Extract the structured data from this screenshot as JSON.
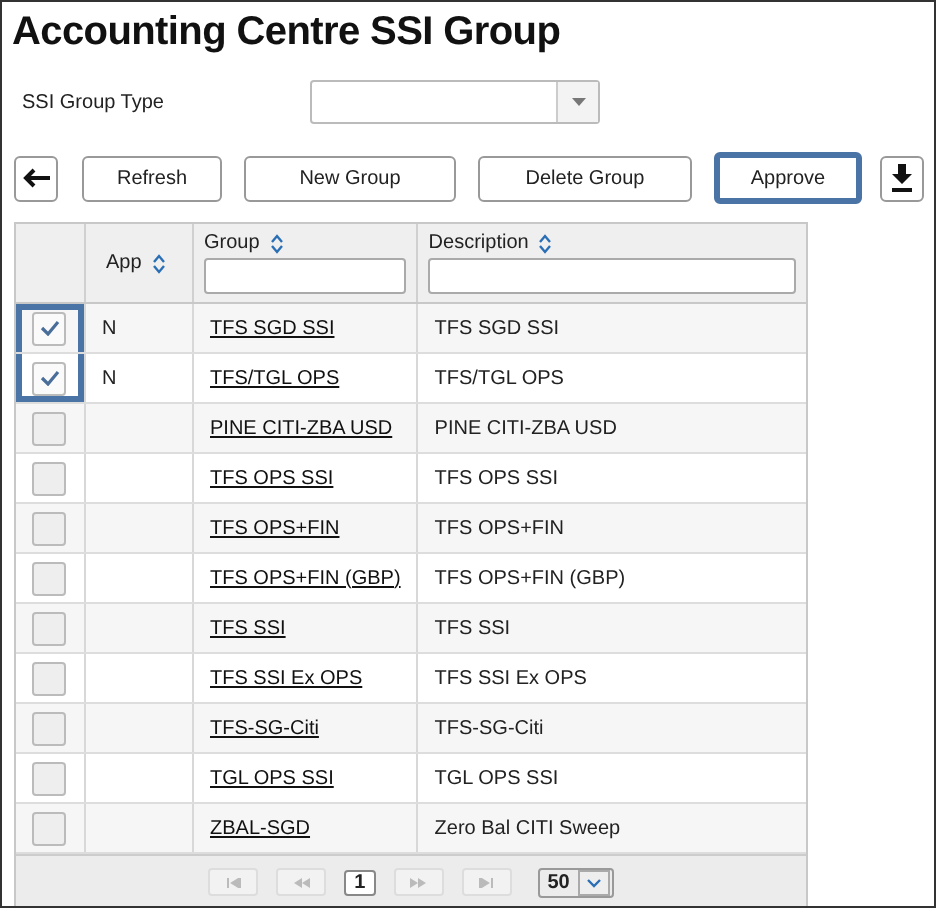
{
  "title": "Accounting Centre SSI Group",
  "filter": {
    "label": "SSI Group Type"
  },
  "toolbar": {
    "buttons": [
      {
        "label": "Refresh",
        "highlighted": false
      },
      {
        "label": "New Group",
        "highlighted": false
      },
      {
        "label": "Delete Group",
        "highlighted": false
      },
      {
        "label": "Approve",
        "highlighted": true
      }
    ]
  },
  "table": {
    "columns": [
      {
        "label": "App",
        "filter": false
      },
      {
        "label": "Group",
        "filter": true
      },
      {
        "label": "Description",
        "filter": true
      }
    ],
    "rows": [
      {
        "checked": true,
        "highlighted": true,
        "app": "N",
        "group": "TFS SGD SSI",
        "description": "TFS SGD SSI"
      },
      {
        "checked": true,
        "highlighted": true,
        "app": "N",
        "group": "TFS/TGL OPS",
        "description": "TFS/TGL OPS"
      },
      {
        "checked": false,
        "highlighted": false,
        "app": "",
        "group": "PINE CITI-ZBA USD",
        "description": "PINE CITI-ZBA USD"
      },
      {
        "checked": false,
        "highlighted": false,
        "app": "",
        "group": "TFS OPS SSI",
        "description": "TFS OPS SSI"
      },
      {
        "checked": false,
        "highlighted": false,
        "app": "",
        "group": "TFS OPS+FIN",
        "description": "TFS OPS+FIN"
      },
      {
        "checked": false,
        "highlighted": false,
        "app": "",
        "group": "TFS OPS+FIN (GBP)",
        "description": "TFS OPS+FIN (GBP)"
      },
      {
        "checked": false,
        "highlighted": false,
        "app": "",
        "group": "TFS SSI",
        "description": "TFS SSI"
      },
      {
        "checked": false,
        "highlighted": false,
        "app": "",
        "group": "TFS SSI Ex OPS",
        "description": "TFS SSI Ex OPS"
      },
      {
        "checked": false,
        "highlighted": false,
        "app": "",
        "group": "TFS-SG-Citi",
        "description": "TFS-SG-Citi"
      },
      {
        "checked": false,
        "highlighted": false,
        "app": "",
        "group": "TGL OPS SSI",
        "description": "TGL OPS SSI"
      },
      {
        "checked": false,
        "highlighted": false,
        "app": "",
        "group": "ZBAL-SGD",
        "description": "Zero Bal CITI Sweep"
      }
    ]
  },
  "pager": {
    "page": "1",
    "page_size": "50"
  }
}
